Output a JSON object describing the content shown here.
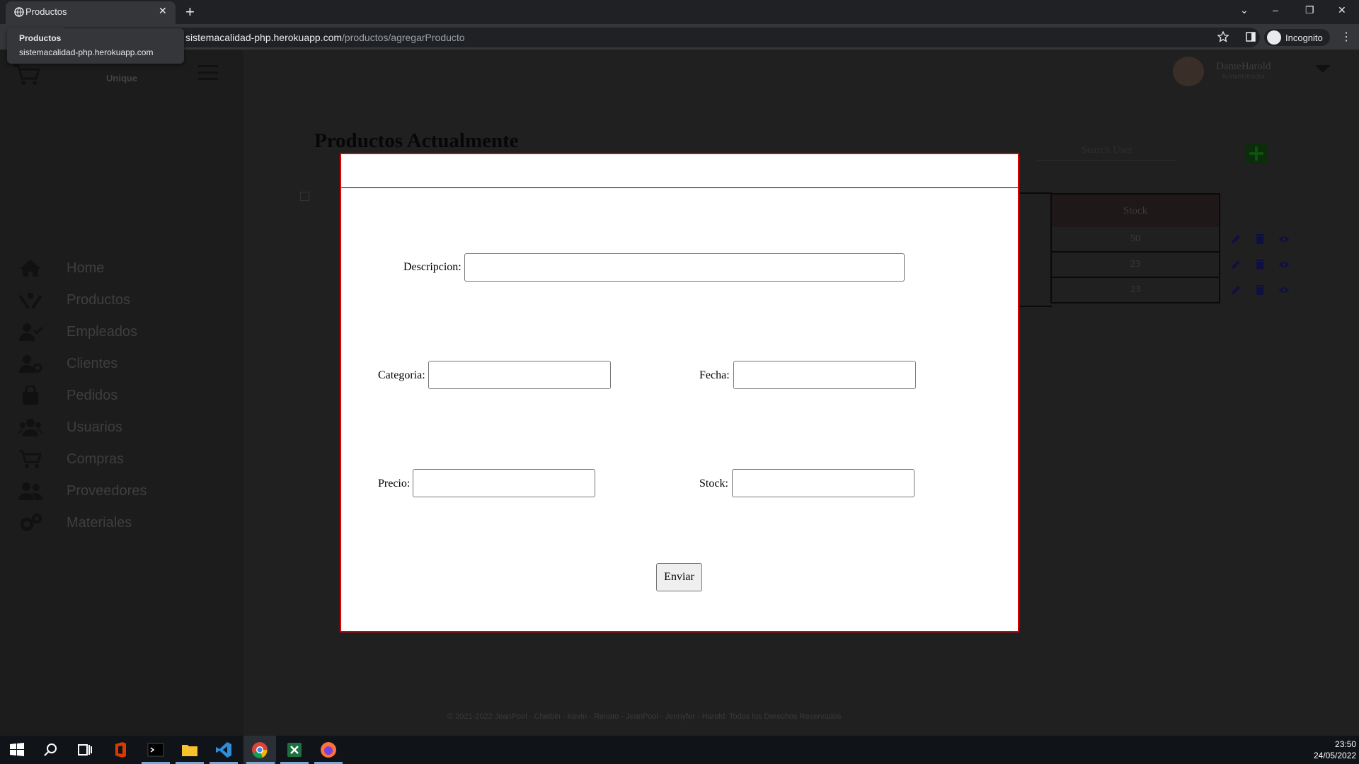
{
  "browser": {
    "tab_title": "Productos",
    "url_host": "sistemacalidad-php.herokuapp.com",
    "url_path": "/productos/agregarProducto",
    "incognito_label": "Incognito",
    "tooltip_title": "Productos",
    "tooltip_url": "sistemacalidad-php.herokuapp.com"
  },
  "app": {
    "brand_sub": "Unique",
    "user_name": "DanteHarold",
    "user_role": "Administrador",
    "page_title": "Productos Actualmente",
    "search_placeholder": "Search User",
    "sidebar": [
      {
        "label": "Home",
        "icon": "home-icon"
      },
      {
        "label": "Productos",
        "icon": "hands-box-icon"
      },
      {
        "label": "Empleados",
        "icon": "user-check-icon"
      },
      {
        "label": "Clientes",
        "icon": "user-cog-icon"
      },
      {
        "label": "Pedidos",
        "icon": "shopping-bag-icon"
      },
      {
        "label": "Usuarios",
        "icon": "users-icon"
      },
      {
        "label": "Compras",
        "icon": "cart-icon"
      },
      {
        "label": "Proveedores",
        "icon": "user-friends-icon"
      },
      {
        "label": "Materiales",
        "icon": "cogs-icon"
      }
    ],
    "table": {
      "stock_header": "Stock",
      "stock_values": [
        "50",
        "23",
        "23"
      ]
    },
    "footer": "© 2021-2022 JeanPool - Chelbin - Kevin - Renato - JeanPool - Jennyfer - Harold. Todos los Derechos Reservados"
  },
  "modal": {
    "descripcion_label": "Descripcion:",
    "categoria_label": "Categoria:",
    "fecha_label": "Fecha:",
    "precio_label": "Precio:",
    "stock_label": "Stock:",
    "submit_label": "Enviar"
  },
  "taskbar": {
    "time": "23:50",
    "date": "24/05/2022"
  }
}
